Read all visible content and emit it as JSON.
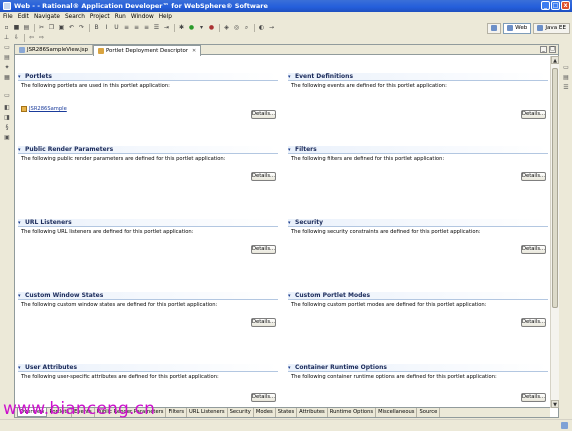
{
  "window": {
    "title": "Web - - Rational® Application Developer™ for WebSphere® Software",
    "btn_minimize": "_",
    "btn_maximize": "□",
    "btn_close": "x"
  },
  "menu": [
    "File",
    "Edit",
    "Navigate",
    "Search",
    "Project",
    "Run",
    "Window",
    "Help"
  ],
  "perspectives": [
    {
      "label": "Web",
      "active": true
    },
    {
      "label": "Java EE",
      "active": false
    }
  ],
  "editor_tabs": [
    {
      "label": "JSR286SampleView.jsp",
      "active": false
    },
    {
      "label": "Portlet Deployment Descriptor",
      "active": true,
      "close": "✕"
    }
  ],
  "sections": [
    {
      "title": "Portlets",
      "description": "The following portlets are used in this portlet application:",
      "button": "Details...",
      "link": "JSR286Sample"
    },
    {
      "title": "Event Definitions",
      "description": "The following events are defined for this portlet application:",
      "button": "Details..."
    },
    {
      "title": "Public Render Parameters",
      "description": "The following public render parameters are defined for this portlet application:",
      "button": "Details..."
    },
    {
      "title": "Filters",
      "description": "The following filters are defined for this portlet application:",
      "button": "Details..."
    },
    {
      "title": "URL Listeners",
      "description": "The following URL listeners are defined for this portlet application:",
      "button": "Details..."
    },
    {
      "title": "Security",
      "description": "The following security constraints are defined for this portlet application:",
      "button": "Details..."
    },
    {
      "title": "Custom Window States",
      "description": "The following custom window states are defined for this portlet application:",
      "button": "Details..."
    },
    {
      "title": "Custom Portlet Modes",
      "description": "The following custom portlet modes are defined for this portlet application:",
      "button": "Details..."
    },
    {
      "title": "User Attributes",
      "description": "The following user-specific attributes are defined for this portlet application:",
      "button": "Details..."
    },
    {
      "title": "Container Runtime Options",
      "description": "The following container runtime options are defined for this portlet application:",
      "button": "Details..."
    }
  ],
  "page_tabs": [
    "Overview",
    "Portlets",
    "Events",
    "Public Render Parameters",
    "Filters",
    "URL Listeners",
    "Security",
    "Modes",
    "States",
    "Attributes",
    "Runtime Options",
    "Miscellaneous",
    "Source"
  ],
  "watermark": "www.bianceng.cn",
  "icons": {
    "app": "eclipse-app-icon",
    "collapse": "▾",
    "scroll_up": "▲",
    "scroll_down": "▼"
  }
}
